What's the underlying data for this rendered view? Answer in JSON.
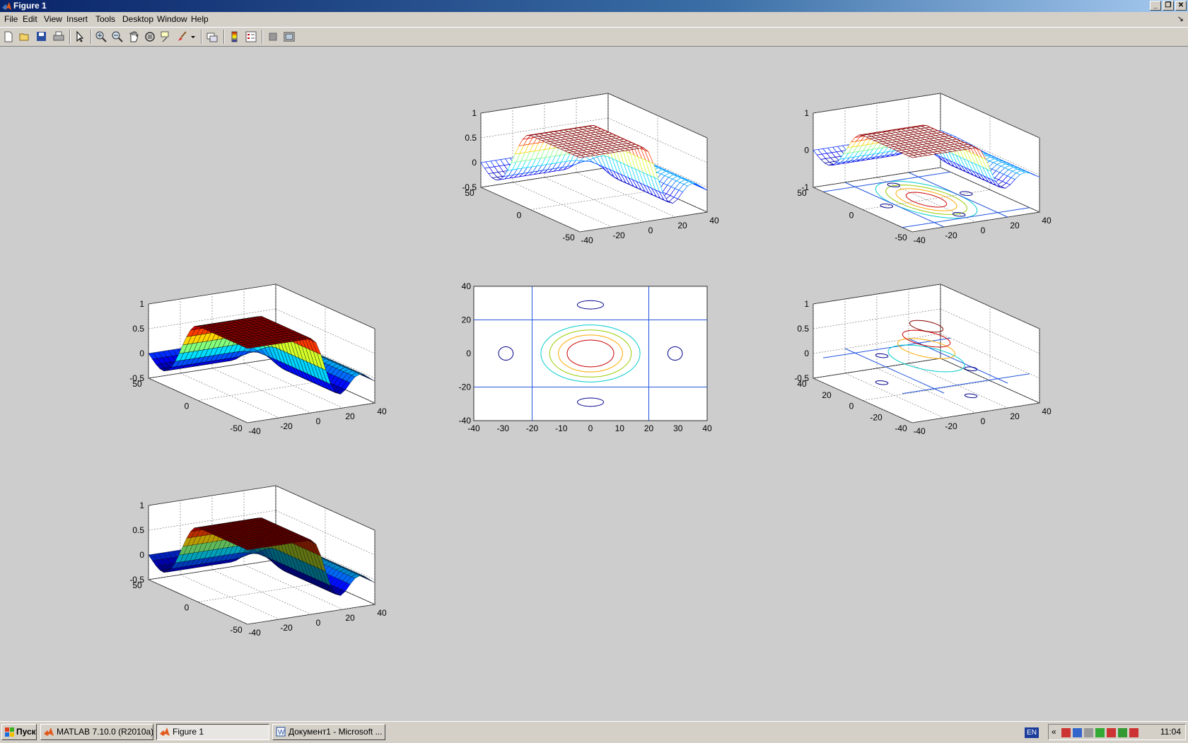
{
  "window": {
    "title": "Figure 1"
  },
  "window_controls": {
    "minimize": "_",
    "restore": "❐",
    "close": "✕"
  },
  "menu": [
    "File",
    "Edit",
    "View",
    "Insert",
    "Tools",
    "Desktop",
    "Window",
    "Help"
  ],
  "menu_dock": "↘",
  "toolbar": [
    "new-figure-icon",
    "open-file-icon",
    "save-icon",
    "print-icon",
    "edit-plot-icon",
    "zoom-in-icon",
    "zoom-out-icon",
    "pan-icon",
    "rotate-3d-icon",
    "data-cursor-icon",
    "brush-icon",
    "brush-dropdown-icon",
    "link-plot-icon",
    "insert-colorbar-icon",
    "insert-legend-icon",
    "hide-plot-tools-icon",
    "show-plot-tools-icon"
  ],
  "chart_data": [
    {
      "type": "surface",
      "subplot": "mesh",
      "colormap": "jet",
      "zlim": [
        -0.5,
        1
      ],
      "z_ticks": [
        "1",
        "0.5",
        "0",
        "-0.5"
      ],
      "x_ticks": [
        "-40",
        "-20",
        "0",
        "20",
        "40"
      ],
      "y_ticks": [
        "-50",
        "0",
        "50"
      ]
    },
    {
      "type": "surface",
      "subplot": "meshc",
      "colormap": "jet",
      "zlim": [
        -1,
        1
      ],
      "z_ticks": [
        "1",
        "0",
        "-1"
      ],
      "x_ticks": [
        "-40",
        "-20",
        "0",
        "20",
        "40"
      ],
      "y_ticks": [
        "-50",
        "0",
        "50"
      ]
    },
    {
      "type": "surface",
      "subplot": "surf",
      "colormap": "jet",
      "zlim": [
        -0.5,
        1
      ],
      "z_ticks": [
        "1",
        "0.5",
        "0",
        "-0.5"
      ],
      "x_ticks": [
        "-40",
        "-20",
        "0",
        "20",
        "40"
      ],
      "y_ticks": [
        "-50",
        "0",
        "50"
      ]
    },
    {
      "type": "contour",
      "subplot": "contour",
      "xlim": [
        -40,
        40
      ],
      "ylim": [
        -40,
        40
      ],
      "x_ticks": [
        "-40",
        "-30",
        "-20",
        "-10",
        "0",
        "10",
        "20",
        "30",
        "40"
      ],
      "y_ticks": [
        "-40",
        "-20",
        "0",
        "20",
        "40"
      ]
    },
    {
      "type": "contour3",
      "subplot": "contour3",
      "zlim": [
        -0.5,
        1
      ],
      "z_ticks": [
        "1",
        "0.5",
        "0",
        "-0.5"
      ],
      "x_ticks": [
        "-40",
        "-20",
        "0",
        "20",
        "40"
      ],
      "y_ticks": [
        "-40",
        "-20",
        "0",
        "20",
        "40"
      ]
    },
    {
      "type": "surface",
      "subplot": "surfl",
      "colormap": "jet",
      "zlim": [
        -0.5,
        1
      ],
      "z_ticks": [
        "1",
        "0.5",
        "0",
        "-0.5"
      ],
      "x_ticks": [
        "-40",
        "-20",
        "0",
        "20",
        "40"
      ],
      "y_ticks": [
        "-50",
        "0",
        "50"
      ]
    }
  ],
  "taskbar": {
    "start": "Пуск",
    "tasks": [
      "MATLAB  7.10.0 (R2010a)",
      "Figure 1",
      "Документ1 - Microsoft ..."
    ],
    "tray_expand": "«",
    "language": "EN",
    "clock": "11:04"
  }
}
